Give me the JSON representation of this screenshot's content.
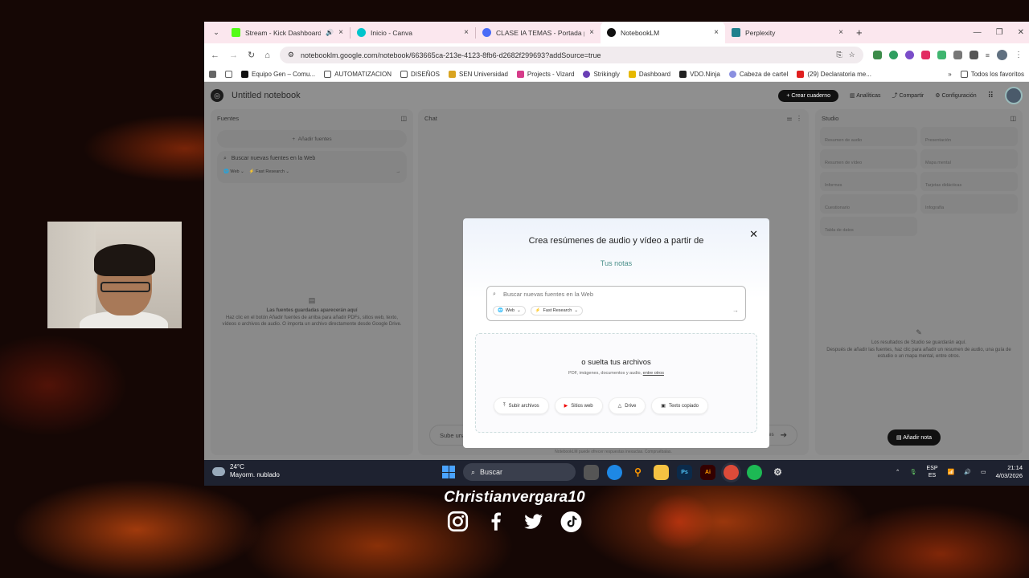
{
  "browser": {
    "tabs": [
      {
        "title": "Stream - Kick Dashboard",
        "favicon": "kick-icon",
        "color": "#53fc18"
      },
      {
        "title": "Inicio - Canva",
        "favicon": "canva-icon",
        "color": "#00c4cc"
      },
      {
        "title": "CLASE IA TEMAS - Portada para",
        "favicon": "drive-icon",
        "color": "#4a6cf7"
      },
      {
        "title": "NotebookLM",
        "favicon": "notebooklm-icon",
        "color": "#111111"
      },
      {
        "title": "Perplexity",
        "favicon": "perplexity-icon",
        "color": "#20808d"
      }
    ],
    "url": "notebooklm.google.com/notebook/663665ca-213e-4123-8fb6-d2682f29969​3?addSource=true",
    "bookmarks": [
      "Equipo Gen – Comu...",
      "AUTOMATIZACION",
      "DISEÑOS",
      "SEN Universidad",
      "Projects - Vizard",
      "Strikingly",
      "Dashboard",
      "VDO.Ninja",
      "Cabeza de cartel",
      "(29) Declaratoria me...",
      "Todos los favoritos"
    ]
  },
  "notebook": {
    "title": "Untitled notebook",
    "create_label": "Crear cuaderno",
    "analytics_label": "Analíticas",
    "share_label": "Compartir",
    "settings_label": "Configuración",
    "sources": {
      "title": "Fuentes",
      "add_label": "Añadir fuentes",
      "search_placeholder": "Buscar nuevas fuentes en la Web",
      "web_chip": "Web",
      "research_chip": "Fast Research",
      "empty_title": "Las fuentes guardadas aparecerán aquí",
      "empty_body": "Haz clic en el botón Añadir fuentes de arriba para añadir PDFs, sitios web, texto, vídeos o archivos de audio. O importa un archivo directamente desde Google Drive."
    },
    "chat": {
      "title": "Chat",
      "input_placeholder": "Sube una fuente para empezar",
      "source_count": "0 fuentes",
      "footer": "NotebookLM puede ofrecer respuestas inexactas. Compruébalas."
    },
    "studio": {
      "title": "Studio",
      "cards": [
        "Resumen de audio",
        "Presentación",
        "Resumen de vídeo",
        "Mapa mental",
        "Informes",
        "Tarjetas didácticas",
        "Cuestionario",
        "Infografía",
        "Tabla de datos"
      ],
      "empty_title": "Los resultados de Studio se guardarán aquí.",
      "empty_body": "Después de añadir las fuentes, haz clic para añadir un resumen de audio, una guía de estudio o un mapa mental, entre otros.",
      "add_note_label": "Añadir nota"
    }
  },
  "modal": {
    "title": "Crea resúmenes de audio y vídeo a partir de",
    "subtitle": "Tus notas",
    "search_placeholder": "Buscar nuevas fuentes en la Web",
    "web_chip": "Web",
    "research_chip": "Fast Research",
    "drop_title": "o suelta tus archivos",
    "drop_sub": "PDF, imágenes, documentos y audio,",
    "drop_sub_link": "entre otros",
    "buttons": [
      "Subir archivos",
      "Sitios web",
      "Drive",
      "Texto copiado"
    ]
  },
  "taskbar": {
    "temp": "24°C",
    "weather": "Mayorm. nublado",
    "search_label": "Buscar",
    "lang1": "ESP",
    "lang2": "ES",
    "time": "21:14",
    "date": "4/03/2026"
  },
  "overlay": {
    "handle": "Christianvergara10"
  }
}
